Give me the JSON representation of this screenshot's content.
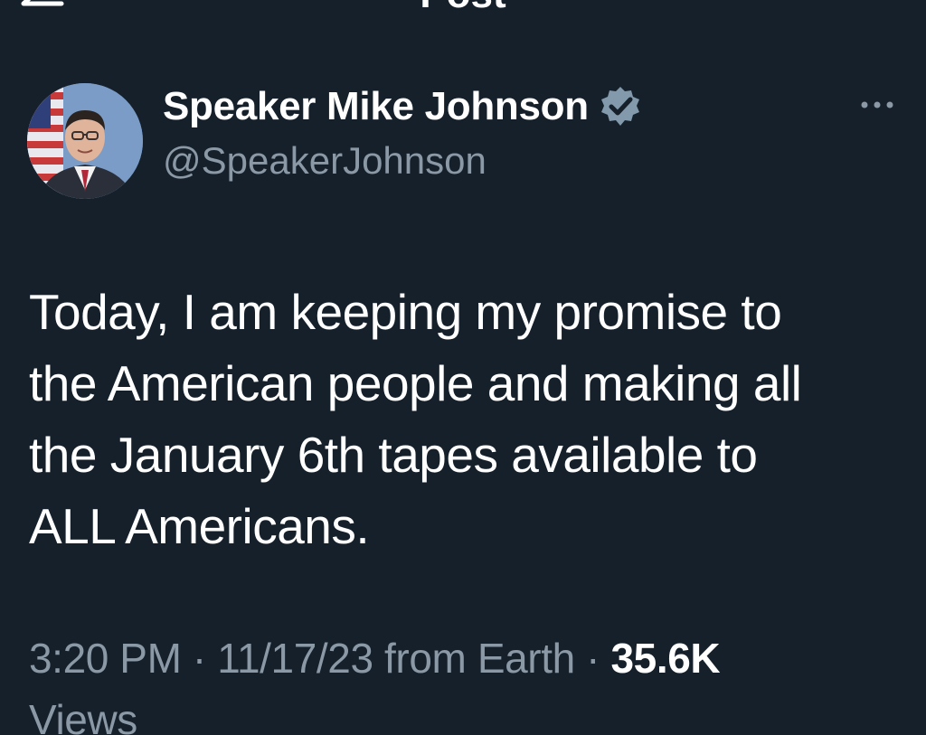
{
  "header": {
    "title": "Post",
    "back_icon": "arrow-left-icon"
  },
  "author": {
    "display_name": "Speaker Mike Johnson",
    "handle": "@SpeakerJohnson",
    "verified_icon": "verified-badge-icon",
    "verified_color": "#829aab",
    "avatar": "avatar-photo"
  },
  "post": {
    "text_lines": [
      "Today, I am keeping my promise to",
      "the American people and making all",
      "the January 6th tapes available to",
      "ALL Americans."
    ],
    "more_icon": "more-options-icon"
  },
  "meta": {
    "time": "3:20 PM",
    "separator": " · ",
    "date": "11/17/23",
    "source": " from Earth",
    "separator2": " · ",
    "views_count": "35.6K",
    "views_label": "Views"
  },
  "colors": {
    "background": "#15202b",
    "primary_text": "#ffffff",
    "secondary_text": "#8b98a5"
  }
}
